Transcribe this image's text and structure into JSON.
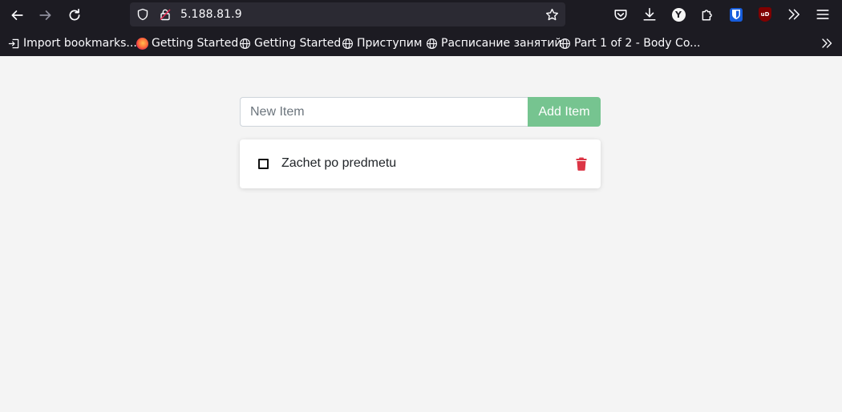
{
  "browser": {
    "url": "5.188.81.9",
    "bookmarks": [
      {
        "label": "Import bookmarks...",
        "icon": "import-icon"
      },
      {
        "label": "Getting Started",
        "icon": "firefox-icon"
      },
      {
        "label": "Getting Started",
        "icon": "globe-icon"
      },
      {
        "label": "Приступим",
        "icon": "globe-icon"
      },
      {
        "label": "Расписание занятий",
        "icon": "globe-icon"
      },
      {
        "label": "Part 1 of 2 - Body Co...",
        "icon": "globe-icon"
      }
    ],
    "extensions": {
      "yandex": "Y",
      "ublock": "uD"
    }
  },
  "todo": {
    "input_placeholder": "New Item",
    "input_value": "",
    "add_button_label": "Add Item",
    "items": [
      {
        "text": "Zachet po predmetu",
        "checked": false
      }
    ]
  },
  "colors": {
    "add_button": "#76c490",
    "delete_icon": "#dc3545",
    "chrome_background": "#1c1b22"
  }
}
